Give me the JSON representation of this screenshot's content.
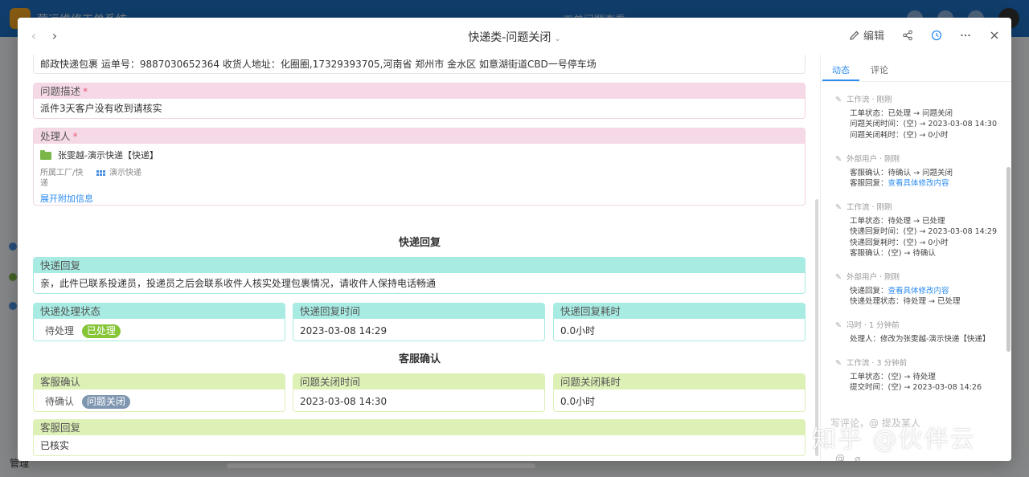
{
  "background": {
    "app_name": "营运维修工单系统",
    "center_title": "工单问题查看",
    "manage_label": "管理",
    "manage_more": "···"
  },
  "modal": {
    "title": "快递类-问题关闭",
    "edit_label": "编辑",
    "prev_icon": "chevron-left-icon",
    "next_icon": "chevron-right-icon"
  },
  "fields": {
    "address": "邮政快递包裹 运单号：9887030652364 收货人地址：化圈圈,17329393705,河南省 郑州市 金水区 如意湖街道CBD一号停车场",
    "problem_desc": {
      "label": "问题描述",
      "required": "*",
      "value": "派件3天客户没有收到请核实"
    },
    "handler": {
      "label": "处理人",
      "required": "*",
      "name": "张雯越-演示快递【快递】",
      "meta_left": "所属工厂/快递",
      "meta_right": "演示快递",
      "expand": "展开附加信息"
    }
  },
  "sections": {
    "express_reply": "快递回复",
    "service_confirm": "客服确认"
  },
  "express": {
    "reply": {
      "label": "快递回复",
      "value": "亲，此件已联系投递员，投递员之后会联系收件人核实处理包裹情况，请收件人保持电话畅通"
    },
    "status": {
      "label": "快递处理状态",
      "option": "待处理",
      "selected": "已处理"
    },
    "reply_time": {
      "label": "快递回复时间",
      "value": "2023-03-08 14:29"
    },
    "reply_duration": {
      "label": "快递回复耗时",
      "value": "0.0小时"
    }
  },
  "service": {
    "confirm": {
      "label": "客服确认",
      "option": "待确认",
      "selected": "问题关闭"
    },
    "close_time": {
      "label": "问题关闭时间",
      "value": "2023-03-08 14:30"
    },
    "close_duration": {
      "label": "问题关闭耗时",
      "value": "0.0小时"
    },
    "reply": {
      "label": "客服回复",
      "value": "已核实"
    }
  },
  "side": {
    "tabs": [
      "动态",
      "评论"
    ],
    "feed": [
      {
        "title": "工作流 · 刚刚",
        "lines": [
          "工单状态：已处理 → 问题关闭",
          "问题关闭时间：(空) → 2023-03-08 14:30",
          "问题关闭耗时：(空) → 0小时"
        ]
      },
      {
        "title": "外部用户 · 刚刚",
        "lines": [
          "客服确认：待确认 → 问题关闭"
        ],
        "link_prefix": "客服回复：",
        "link_text": "查看具体修改内容"
      },
      {
        "title": "工作流 · 刚刚",
        "lines": [
          "工单状态：待处理 → 已处理",
          "快递回复时间：(空) → 2023-03-08 14:29",
          "快递回复耗时：(空) → 0小时",
          "客服确认：(空) → 待确认"
        ]
      },
      {
        "title": "外部用户 · 刚刚",
        "link_prefix": "快递回复：",
        "link_text": "查看具体修改内容",
        "lines_after": [
          "快递处理状态：待处理 → 已处理"
        ]
      },
      {
        "title": "冯时 · 1 分钟前",
        "lines": [
          "处理人：修改为张雯越-演示快递【快递】"
        ]
      },
      {
        "title": "工作流 · 3 分钟前",
        "lines": [
          "工单状态：(空) → 待处理",
          "提交时间：(空) → 2023-03-08 14:26"
        ]
      }
    ],
    "comment_placeholder": "写评论，@ 提及某人"
  },
  "watermark": "知乎 @伙伴云",
  "colors": {
    "pink_header": "#f6d9e6",
    "cyan_header": "#a7ebe2",
    "green_header": "#ddf0b6",
    "accent": "#2d8cf0",
    "pill_green": "#86c438",
    "pill_slate": "#7f96b0"
  }
}
